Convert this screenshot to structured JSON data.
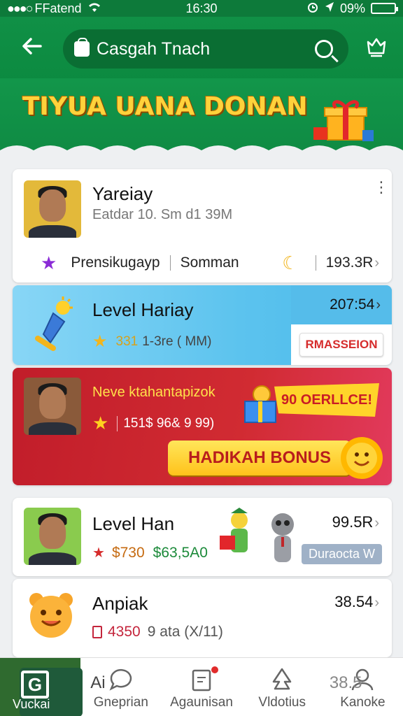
{
  "status": {
    "carrier": "FFatend",
    "time": "16:30",
    "battery": "09%",
    "battery_level": 0.09
  },
  "header": {
    "search_placeholder": "Casgah Tnach"
  },
  "banner": {
    "title": "TIYUA UANA DONAN"
  },
  "cards": [
    {
      "name": "Yareiay",
      "subtitle": "Eatdar 10. Sm d1 39M",
      "stat1": "Prensikugayp",
      "stat2": "Somman",
      "value": "193.3R"
    },
    {
      "name": "Level Hariay",
      "rank_num": "331",
      "rank_text": "1-3re ( MM)",
      "value": "207:54",
      "button": "RMASSEION"
    },
    {
      "name": "Neve ktahantapizok",
      "stats": "151$ 96& 9 99)",
      "offer": "90 OERLLCE!",
      "bonus": "HADIKAH BONUS"
    },
    {
      "name": "Level Han",
      "amount1": "$730",
      "amount2": "$63,5A0",
      "value": "99.5R",
      "badge": "Duraocta W"
    },
    {
      "name": "Anpiak",
      "amount": "4350",
      "rest": "9 ata (X/11)",
      "value": "38.54"
    }
  ],
  "nav": [
    {
      "label": "Vuckai",
      "overlay": "Ai"
    },
    {
      "label": "Gneprian",
      "overlay": ""
    },
    {
      "label": "Agaunisan",
      "overlay": ""
    },
    {
      "label": "Vldotius",
      "overlay": ""
    },
    {
      "label": "Kanoke",
      "overlay": "38.5"
    }
  ]
}
